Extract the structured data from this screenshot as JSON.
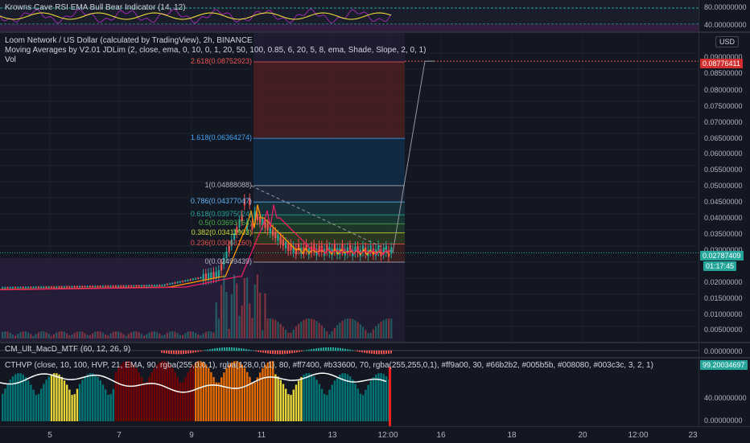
{
  "colors": {
    "bg": "#131722",
    "up": "#26a69a",
    "down": "#ef5350",
    "grid": "#1e222d",
    "text": "#d1d4dc",
    "current_price_bg": "#26a69a",
    "target_badge_bg": "#d32f2f"
  },
  "rsi_pane": {
    "title": "Krowns Cave RSI EMA Bull Bear Indicator (14, 12)",
    "scale_ticks": [
      "80.00000000",
      "40.00000000"
    ]
  },
  "main_pane": {
    "title": "Loom Network / US Dollar (calculated by TradingView), 2h, BINANCE",
    "ma_legend": "Moving Averages by V2.01 JDLim (2, close, ema, 0, 10, 0, 1, 20, 50, 100, 0.85, 6, 20, 5, 8, ema, Shade, Slope, 2, 0, 1)",
    "vol_legend": "Vol",
    "currency_label": "USD",
    "scale_ticks": [
      "0.09000000",
      "0.08500000",
      "0.08000000",
      "0.07500000",
      "0.07000000",
      "0.06500000",
      "0.06000000",
      "0.05500000",
      "0.05000000",
      "0.04500000",
      "0.04000000",
      "0.03500000",
      "0.03000000",
      "0.02000000",
      "0.01500000",
      "0.01000000",
      "0.00500000"
    ],
    "tick_partial": "0.",
    "target_price": "0.08776411",
    "current_price": "0.02787409",
    "countdown": "01:17:45",
    "fib_levels": [
      {
        "label": "2.618(0.08752923)",
        "color": "#ef5350",
        "price": 0.08752923
      },
      {
        "label": "1.618(0.06364274)",
        "color": "#42a5f5",
        "price": 0.06364274
      },
      {
        "label": "1(0.04888088)",
        "color": "#b2b5be",
        "price": 0.04888088
      },
      {
        "label": "0.786(0.04377047)",
        "color": "#64b5f6",
        "price": 0.04377047
      },
      {
        "label": "0.618(0.03975024)",
        "color": "#26a69a",
        "price": 0.03975024
      },
      {
        "label": "0.5(0.03693764)",
        "color": "#4caf50",
        "price": 0.03693764
      },
      {
        "label": "0.382(0.03411903)",
        "color": "#cddc39",
        "price": 0.03411903
      },
      {
        "label": "0.236(0.03063160)",
        "color": "#ef5350",
        "price": 0.0306316
      },
      {
        "label": "0(0.02499439)",
        "color": "#b2b5be",
        "price": 0.02499439
      }
    ]
  },
  "macd_pane": {
    "title": "CM_Ult_MacD_MTF (60, 12, 26, 9)",
    "scale_ticks": [
      "0.00000000"
    ]
  },
  "hvp_pane": {
    "title": "CTHVP (close, 10, 100, HVP, 21, EMA, 90, rgba(255,0,0,1), rgba(128,0,0,1), 80, #ff7400, #b33600, 70, rgba(255,255,0,1), #ff9a00, 30, #66b2b2, #005b5b, #008080, #003c3c, 3, 2, 1)",
    "value_badge": "99.20034697",
    "scale_ticks": [
      "40.00000000",
      "0.00000000"
    ]
  },
  "time_axis": {
    "labels": [
      "5",
      "7",
      "9",
      "11",
      "13",
      "12:00",
      "16",
      "18",
      "20",
      "12:00",
      "23"
    ]
  }
}
